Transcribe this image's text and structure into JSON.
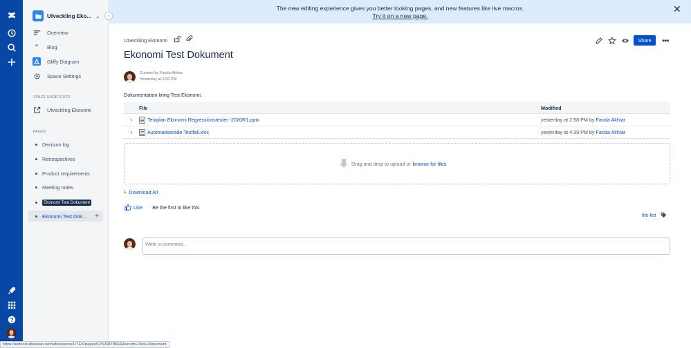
{
  "colors": {
    "rail": "#0747a6",
    "accent": "#0052cc",
    "banner": "#deebff",
    "sidebar": "#f4f5f7"
  },
  "rail": {
    "icons": [
      "confluence-logo-icon",
      "recent-icon",
      "search-icon",
      "create-plus-icon",
      "whats-new-rocket-icon",
      "app-switcher-icon",
      "help-icon",
      "profile-avatar"
    ]
  },
  "sidebar": {
    "space_title": "Utveckling Eko...",
    "nav": [
      {
        "label": "Overview",
        "icon": "overview-icon"
      },
      {
        "label": "Blog",
        "icon": "blog-quote-icon"
      },
      {
        "label": "Gliffy Diagram",
        "icon": "gliffy-icon"
      },
      {
        "label": "Space Settings",
        "icon": "gear-icon"
      }
    ],
    "shortcuts_heading": "SPACE SHORTCUTS",
    "shortcut": "Utveckling Ekonomi",
    "pages_heading": "PAGES",
    "pages": [
      "Decision log",
      "Retrospectives",
      "Product requirements",
      "Meeting notes",
      "Ekonomi Test Dokument",
      "Ekonomi Test Dok..."
    ]
  },
  "banner": {
    "text": "The new editing experience gives you better looking pages, and new features like live macros.",
    "link": "Try it on a new page."
  },
  "page": {
    "breadcrumb": "Utveckling Ekonomi",
    "title": "Ekonomi Test Dokument",
    "share": "Share",
    "created_by": "Created by Farida Akhtar",
    "created_at": "Yesterday at 2:50 PM",
    "description": "Dokumentation kring Test Ekonomi."
  },
  "files": {
    "col_file": "File",
    "col_modified": "Modified",
    "rows": [
      {
        "name": "Testplan Ekonomi Regressionstester -2020R1.pptx",
        "modified": "yesterday at 2:58 PM by",
        "author": "Farida Akhtar"
      },
      {
        "name": "Automatiserade Testfall.xlsx",
        "modified": "yesterday at 4:39 PM by",
        "author": "Farida Akhtar"
      }
    ],
    "drop_text": "Drag and drop to upload or",
    "drop_link": "browse for files",
    "download_all": "Download All"
  },
  "social": {
    "like": "Like",
    "like_text": "Be the first to like this",
    "label": "file-list"
  },
  "comment": {
    "placeholder": "Write a comment..."
  },
  "status_url": "https://axfood.atlassian.net/wiki/spaces/UTEK/pages/1252687966/Ekonomi+Test+Dokument"
}
